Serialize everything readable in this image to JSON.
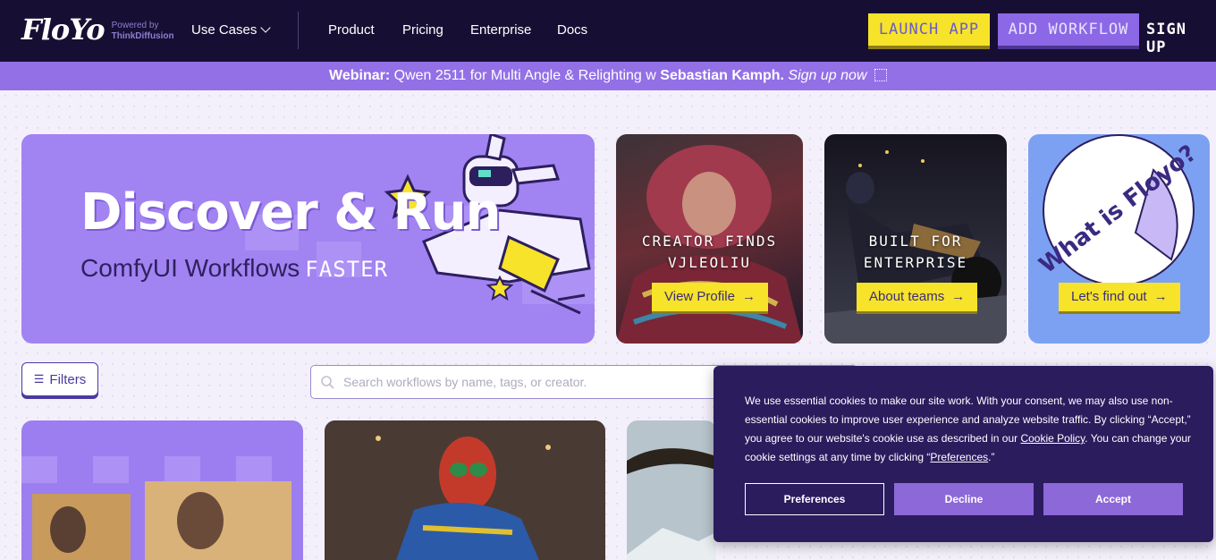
{
  "nav": {
    "logo": "FloYo",
    "powered_by": "Powered by",
    "powered_company": "ThinkDiffusion",
    "use_cases": "Use Cases",
    "links": [
      "Product",
      "Pricing",
      "Enterprise",
      "Docs"
    ],
    "launch_app": "LAUNCH APP",
    "add_workflow": "ADD WORKFLOW",
    "sign_up": "SIGN UP"
  },
  "banner": {
    "label": "Webinar:",
    "text": " Qwen 2511 for Multi Angle & Relighting w ",
    "speaker": "Sebastian Kamph.",
    "cta": " Sign up now",
    "icon": "hand-pointer-icon"
  },
  "hero": {
    "title": "Discover & Run",
    "subtitle": "ComfyUI Workflows",
    "faster": "FASTER",
    "color_bg": "#a283f2"
  },
  "promos": [
    {
      "title": "CREATOR FINDS\nVJLEOLIU",
      "button": "View Profile"
    },
    {
      "title": "BUILT FOR\nENTERPRISE",
      "button": "About teams"
    },
    {
      "sticker": "What is Floyo?",
      "button": "Let's find out"
    }
  ],
  "filters": {
    "label": "Filters",
    "icon": "sliders-icon"
  },
  "search": {
    "placeholder": "Search workflows by name, tags, or creator."
  },
  "cookie": {
    "text1": "We use essential cookies to make our site work. With your consent, we may also use non-essential cookies to improve user experience and analyze website traffic. By clicking “Accept,” you agree to our website's cookie use as described in our ",
    "policy_link": "Cookie Policy",
    "text2": ". You can change your cookie settings at any time by clicking “",
    "prefs_link": "Preferences",
    "text3": ".”",
    "btn_preferences": "Preferences",
    "btn_decline": "Decline",
    "btn_accept": "Accept"
  },
  "colors": {
    "nav_bg": "#170f33",
    "accent_purple": "#9370e6",
    "yellow": "#f6e32a",
    "cookie_bg": "#2b1c5e"
  }
}
